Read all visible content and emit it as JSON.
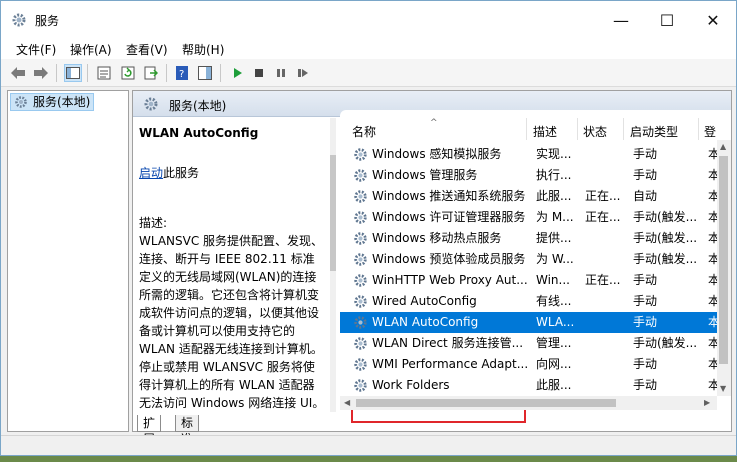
{
  "window": {
    "title": "服务",
    "minimize_glyph": "—",
    "maximize_glyph": "☐",
    "close_glyph": "✕"
  },
  "menu": [
    "文件(F)",
    "操作(A)",
    "查看(V)",
    "帮助(H)"
  ],
  "toolbar": {
    "icons": [
      "back-arrow-icon",
      "forward-arrow-icon",
      "console-tree-icon",
      "properties-icon",
      "refresh-icon",
      "export-list-icon",
      "help-icon",
      "show-hide-action-pane-icon",
      "play-icon",
      "stop-icon",
      "pause-icon",
      "restart-icon"
    ]
  },
  "tree": {
    "root_label": "服务(本地)"
  },
  "main": {
    "header_label": "服务(本地)",
    "selected_service_name": "WLAN AutoConfig",
    "start_link": "启动",
    "start_suffix": "此服务",
    "description_label": "描述:",
    "description_text": "WLANSVC 服务提供配置、发现、连接、断开与 IEEE 802.11 标准定义的无线局域网(WLAN)的连接所需的逻辑。它还包含将计算机变成软件访问点的逻辑，以便其他设备或计算机可以使用支持它的 WLAN 适配器无线连接到计算机。停止或禁用 WLANSVC 服务将使得计算机上的所有 WLAN 适配器无法访问 Windows 网络连接 UI。强烈建议: 如果你的计算机具"
  },
  "columns": {
    "name": "名称",
    "description": "描述",
    "status": "状态",
    "startup": "启动类型",
    "logon": "登"
  },
  "services": [
    {
      "name": "Windows 感知模拟服务",
      "description": "实现...",
      "status": "",
      "startup": "手动",
      "logon": "本"
    },
    {
      "name": "Windows 管理服务",
      "description": "执行...",
      "status": "",
      "startup": "手动",
      "logon": "本"
    },
    {
      "name": "Windows 推送通知系统服务",
      "description": "此服...",
      "status": "正在...",
      "startup": "自动",
      "logon": "本"
    },
    {
      "name": "Windows 许可证管理器服务",
      "description": "为 M...",
      "status": "正在...",
      "startup": "手动(触发...",
      "logon": "本"
    },
    {
      "name": "Windows 移动热点服务",
      "description": "提供...",
      "status": "",
      "startup": "手动(触发...",
      "logon": "本"
    },
    {
      "name": "Windows 预览体验成员服务",
      "description": "为 W...",
      "status": "",
      "startup": "手动(触发...",
      "logon": "本"
    },
    {
      "name": "WinHTTP Web Proxy Aut...",
      "description": "Win...",
      "status": "正在...",
      "startup": "手动",
      "logon": "本"
    },
    {
      "name": "Wired AutoConfig",
      "description": "有线...",
      "status": "",
      "startup": "手动",
      "logon": "本"
    },
    {
      "name": "WLAN AutoConfig",
      "description": "WLA...",
      "status": "",
      "startup": "手动",
      "logon": "本",
      "selected": true
    },
    {
      "name": "WLAN Direct 服务连接管...",
      "description": "管理...",
      "status": "",
      "startup": "手动(触发...",
      "logon": "本"
    },
    {
      "name": "WMI Performance Adapt...",
      "description": "向网...",
      "status": "",
      "startup": "手动",
      "logon": "本"
    },
    {
      "name": "Work Folders",
      "description": "此服...",
      "status": "",
      "startup": "手动",
      "logon": "本"
    }
  ],
  "bottom_tabs": [
    "扩展",
    "标准"
  ],
  "colors": {
    "selection": "#0078d7",
    "highlight_border": "#e0262b",
    "link": "#0645ad"
  }
}
